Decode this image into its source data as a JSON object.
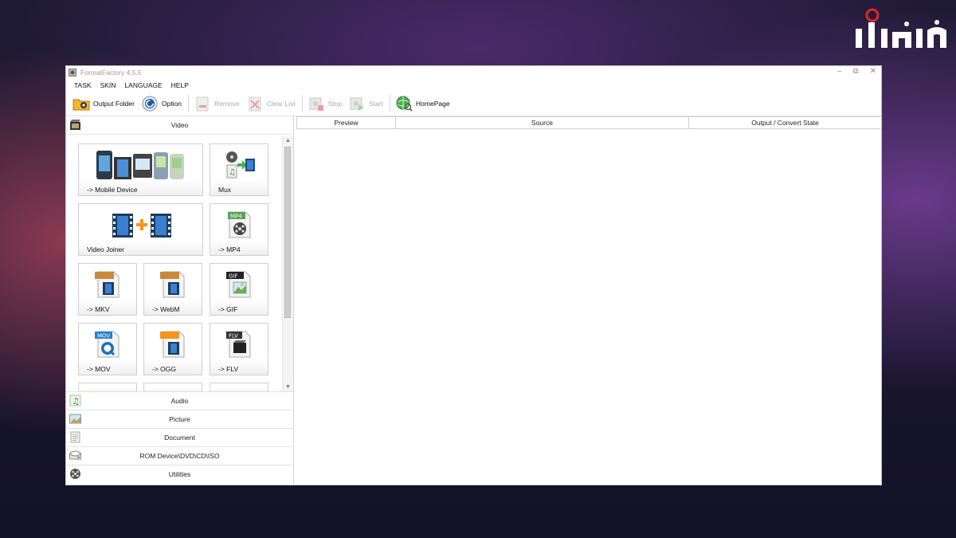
{
  "watermark": {
    "logo_text": "آی‌تی‌باز"
  },
  "window": {
    "title": "FormatFactory 4.5.5",
    "controls": {
      "minimize": "–",
      "restore": "⧉",
      "close": "✕"
    }
  },
  "menu": [
    "TASK",
    "SKIN",
    "LANGUAGE",
    "HELP"
  ],
  "toolbar": {
    "output_folder": "Output Folder",
    "option": "Option",
    "remove": "Remove",
    "clear_list": "Clear List",
    "stop": "Stop",
    "start": "Start",
    "homepage": "HomePage"
  },
  "categories": {
    "video": "Video",
    "audio": "Audio",
    "picture": "Picture",
    "document": "Document",
    "rom": "ROM Device\\DVD\\CD\\ISO",
    "utilities": "Utilities"
  },
  "video_tiles": [
    "-> Mobile Device",
    "Mux",
    "Video Joiner",
    "-> MP4",
    "-> MKV",
    "-> WebM",
    "-> GIF",
    "-> MOV",
    "-> OGG",
    "-> FLV"
  ],
  "file_badges": {
    "mp4": "MP4",
    "gif": "GIF",
    "mov": "MOV",
    "flv": "FLV"
  },
  "task_table": {
    "columns": [
      "Preview",
      "Source",
      "Output / Convert State"
    ]
  },
  "colors": {
    "accent_orange": "#f7941d",
    "film_blue": "#3a7fd0"
  }
}
